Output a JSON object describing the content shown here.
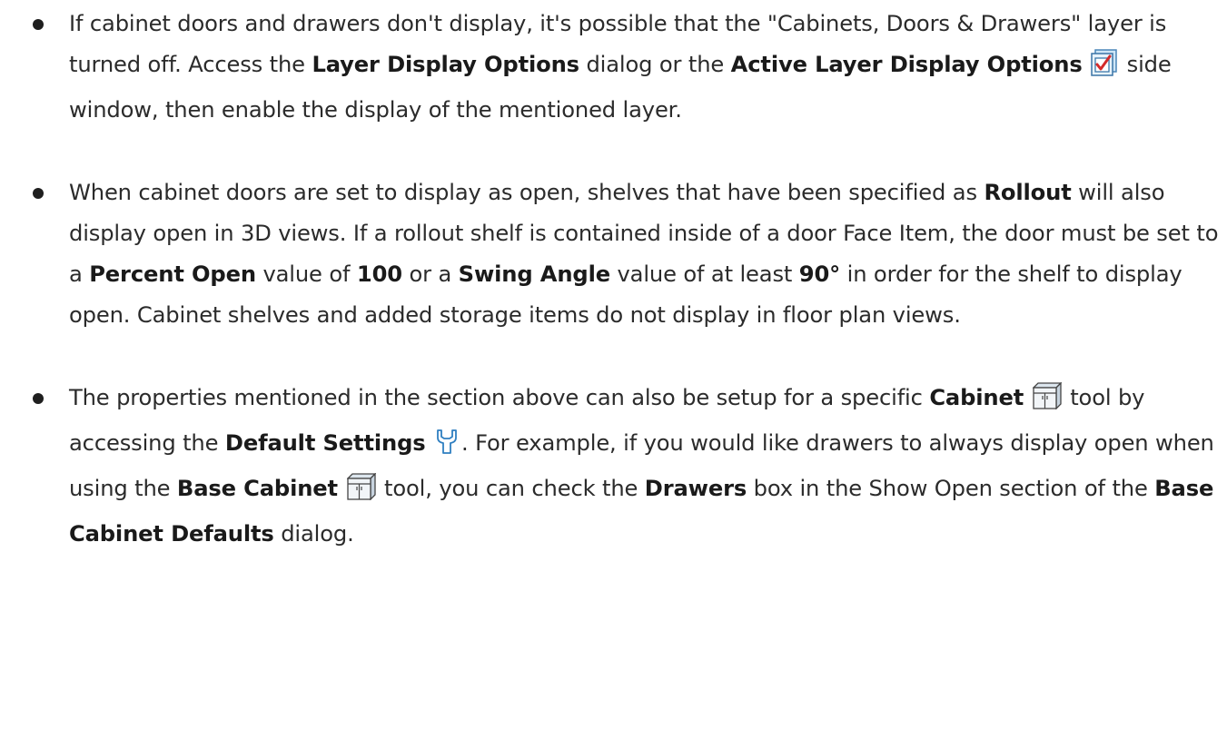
{
  "items": [
    {
      "t1": "If cabinet doors and drawers don't display, it's possible that the \"Cabinets, Doors & Drawers\" layer is turned off. Access the ",
      "b1": "Layer Display Options",
      "t2": " dialog or the ",
      "b2": "Active Layer Display Options",
      "t3": " side window, then enable the display of the mentioned layer."
    },
    {
      "t1": "When cabinet doors are set to display as open, shelves that have been specified as ",
      "b1": "Rollout",
      "t2": " will also display open in 3D views. If a rollout shelf is contained inside of a door Face Item, the door must be set to a ",
      "b2": "Percent Open",
      "t3": " value of ",
      "b3": "100",
      "t4": " or a ",
      "b4": "Swing Angle",
      "t5": " value of at least ",
      "b5": "90°",
      "t6": " in order for the shelf to display open. Cabinet shelves and added storage items do not display in floor plan views."
    },
    {
      "t1": "The properties mentioned in the section above can also be setup for a specific ",
      "b1": "Cabinet",
      "t2": " tool by accessing the ",
      "b2": "Default Settings",
      "t3": ". For example, if you would like drawers to always display open when using the ",
      "b3": "Base Cabinet",
      "t4": " tool, you can check the ",
      "b4": "Drawers",
      "t5": " box in the Show Open section of the ",
      "b5": "Base Cabinet Defaults",
      "t6": " dialog."
    }
  ],
  "icons": {
    "layer_display": "active-layer-display-options-icon",
    "cabinet": "cabinet-icon",
    "default_settings": "default-settings-wrench-icon"
  }
}
